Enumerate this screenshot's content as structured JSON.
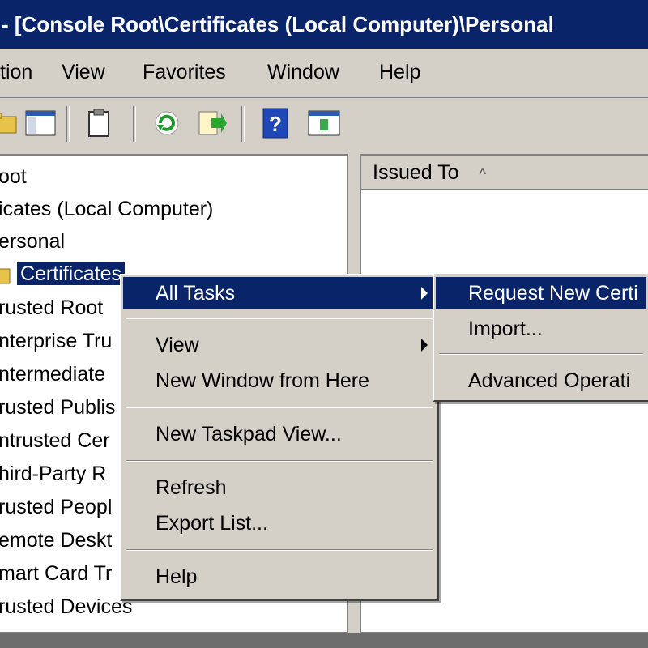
{
  "window": {
    "title": "- [Console Root\\Certificates (Local Computer)\\Personal"
  },
  "menubar": {
    "items": [
      "tion",
      "View",
      "Favorites",
      "Window",
      "Help"
    ]
  },
  "toolbar": {
    "icons": [
      "folder-icon",
      "show-hide-tree-icon",
      "clipboard-icon",
      "refresh-icon",
      "export-list-icon",
      "help-icon",
      "new-window-icon"
    ]
  },
  "tree": {
    "items": [
      {
        "label": "oot"
      },
      {
        "label": "icates (Local Computer)"
      },
      {
        "label": "ersonal"
      },
      {
        "label": "Certificates"
      },
      {
        "label": "rusted Root"
      },
      {
        "label": "nterprise Tru"
      },
      {
        "label": "ntermediate"
      },
      {
        "label": "rusted Publis"
      },
      {
        "label": "ntrusted Cer"
      },
      {
        "label": "hird-Party R"
      },
      {
        "label": "rusted Peopl"
      },
      {
        "label": "emote Deskt"
      },
      {
        "label": "mart Card Tr"
      },
      {
        "label": "rusted Devices"
      }
    ]
  },
  "list": {
    "column_header": "Issued To",
    "sort_indicator": "^"
  },
  "context_menu": {
    "items": [
      {
        "label": "All Tasks"
      },
      {
        "label": "View"
      },
      {
        "label": "New Window from Here"
      },
      {
        "label": "New Taskpad View..."
      },
      {
        "label": "Refresh"
      },
      {
        "label": "Export List..."
      },
      {
        "label": "Help"
      }
    ]
  },
  "submenu": {
    "items": [
      {
        "label": "Request New Certi"
      },
      {
        "label": "Import..."
      },
      {
        "label": "Advanced Operati"
      }
    ]
  },
  "colors": {
    "highlight": "#0a246a",
    "face": "#d4d0c8"
  }
}
